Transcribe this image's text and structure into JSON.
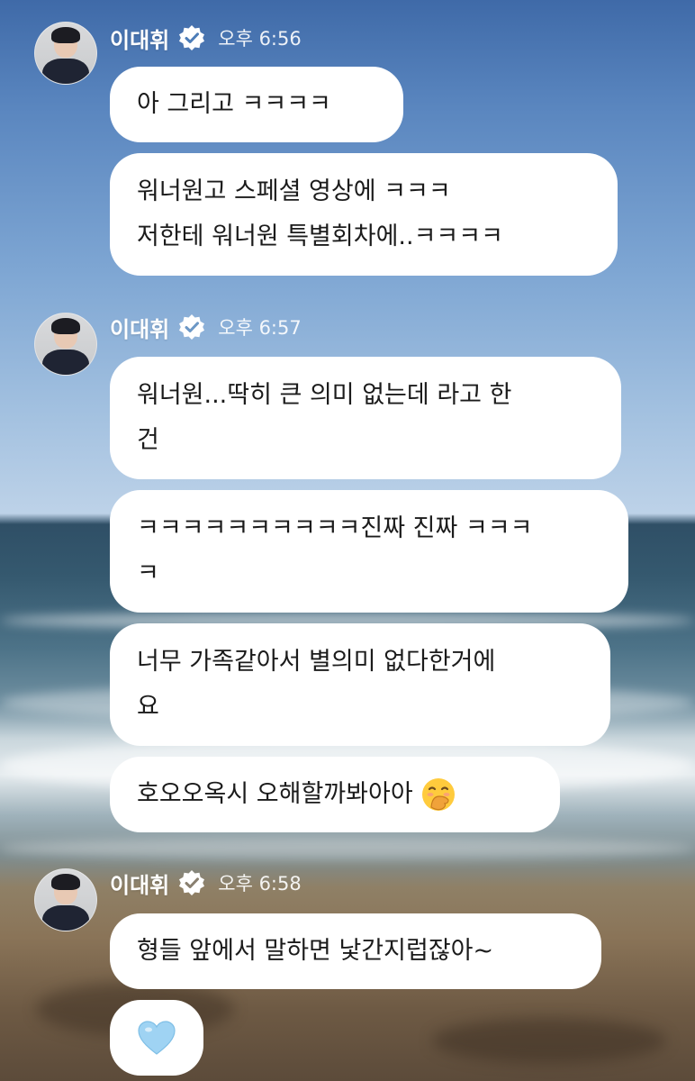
{
  "chat": {
    "groups": [
      {
        "sender": "이대휘",
        "time": "오후 6:56",
        "messages": [
          {
            "text": "아 그리고 ㅋㅋㅋㅋ"
          },
          {
            "text": "워너원고 스페셜 영상에 ㅋㅋㅋ\n저한테 워너원 특별회차에..ㅋㅋㅋㅋ"
          }
        ]
      },
      {
        "sender": "이대휘",
        "time": "오후 6:57",
        "messages": [
          {
            "text": "워너원...딱히 큰 의미 없는데 라고 한\n건"
          },
          {
            "text": "ㅋㅋㅋㅋㅋㅋㅋㅋㅋㅋ진짜 진짜 ㅋㅋㅋ\nㅋ"
          },
          {
            "text": "너무 가족같아서 별의미 없다한거에\n요"
          },
          {
            "text": "호오오옥시 오해할까봐아아",
            "emoji": "face-with-hand-over-mouth"
          }
        ]
      },
      {
        "sender": "이대휘",
        "time": "오후 6:58",
        "messages": [
          {
            "text": "형들 앞에서 말하면 낯간지럽잖아~"
          },
          {
            "text": "",
            "emoji": "light-blue-heart"
          }
        ]
      }
    ]
  },
  "colors": {
    "bubble": "#ffffff",
    "text": "#1b1b1b",
    "name": "#ffffff",
    "heart": "#9fd3f3"
  }
}
